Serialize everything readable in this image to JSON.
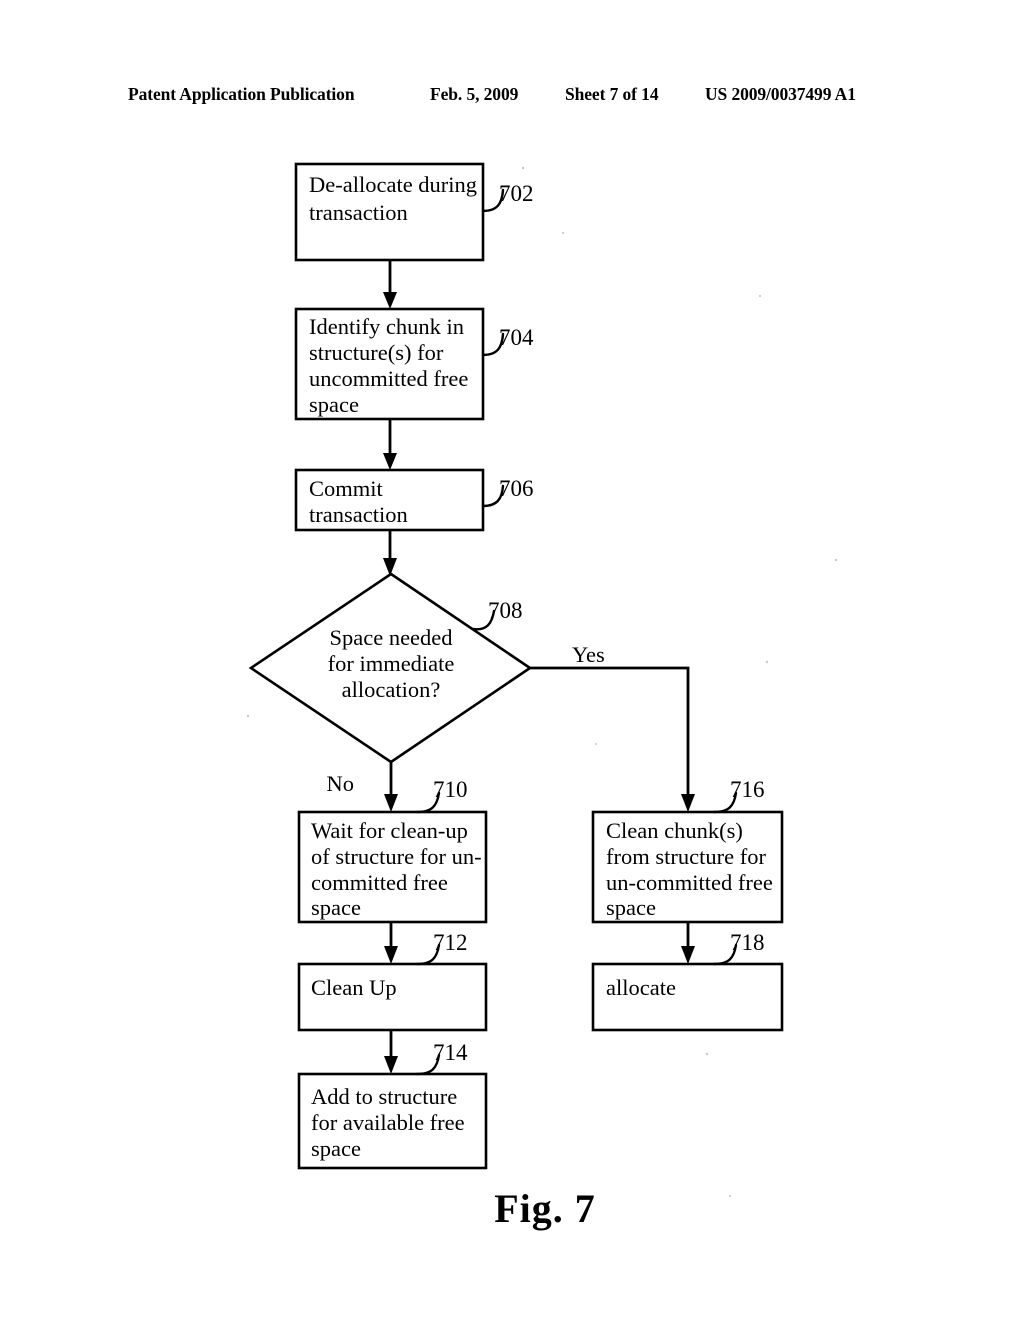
{
  "header": {
    "publication": "Patent Application Publication",
    "date": "Feb. 5, 2009",
    "sheet": "Sheet 7 of 14",
    "patent_number": "US 2009/0037499 A1"
  },
  "figure": {
    "caption": "Fig. 7"
  },
  "nodes": {
    "n702": {
      "ref": "702",
      "lines": [
        "De-allocate during",
        "transaction"
      ]
    },
    "n704": {
      "ref": "704",
      "lines": [
        "Identify chunk in",
        "structure(s) for",
        "uncommitted free",
        "space"
      ]
    },
    "n706": {
      "ref": "706",
      "lines": [
        "Commit",
        "transaction"
      ]
    },
    "n708": {
      "ref": "708",
      "lines": [
        "Space needed",
        "for immediate",
        "allocation?"
      ]
    },
    "n710": {
      "ref": "710",
      "lines": [
        "Wait for clean-up",
        "of structure for un-",
        "committed free",
        "space"
      ]
    },
    "n712": {
      "ref": "712",
      "lines": [
        "Clean Up"
      ]
    },
    "n714": {
      "ref": "714",
      "lines": [
        "Add to structure",
        "for available free",
        "space"
      ]
    },
    "n716": {
      "ref": "716",
      "lines": [
        "Clean chunk(s)",
        "from structure for",
        "un-committed free",
        "space"
      ]
    },
    "n718": {
      "ref": "718",
      "lines": [
        "allocate"
      ]
    }
  },
  "branches": {
    "yes": "Yes",
    "no": "No"
  },
  "colors": {
    "ink": "#000000",
    "paper": "#ffffff"
  }
}
